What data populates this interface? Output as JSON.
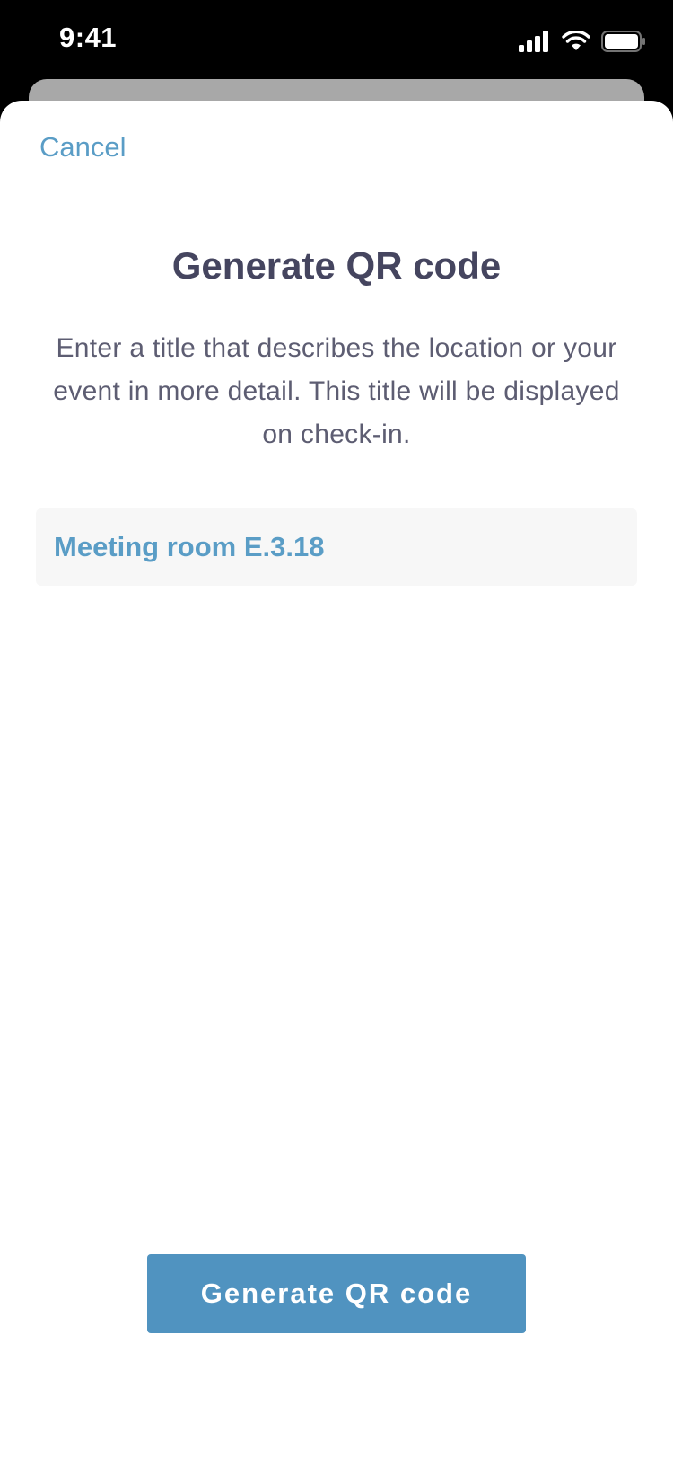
{
  "status_bar": {
    "time": "9:41",
    "icons": [
      "signal-icon",
      "wifi-icon",
      "battery-icon"
    ]
  },
  "modal": {
    "cancel_label": "Cancel",
    "title": "Generate QR code",
    "description": "Enter a title that describes the location or your event in more detail. This title will be displayed on check-in.",
    "title_input": {
      "value": "Meeting room E.3.18"
    },
    "generate_button_label": "Generate QR code"
  },
  "colors": {
    "accent": "#5a9dc6",
    "button": "#5093c0",
    "title_text": "#45455f",
    "body_text": "#5d5d72",
    "input_background": "#f7f7f7"
  }
}
